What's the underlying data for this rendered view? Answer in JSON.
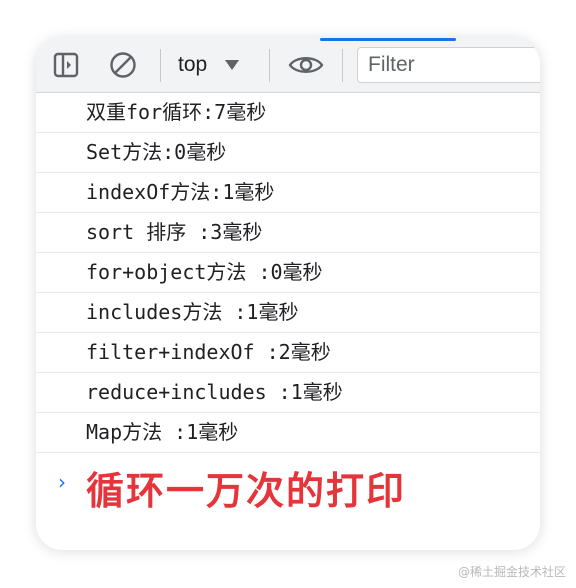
{
  "toolbar": {
    "context_label": "top",
    "filter_placeholder": "Filter"
  },
  "console": {
    "logs": [
      "双重for循环:7毫秒",
      "Set方法:0毫秒",
      "indexOf方法:1毫秒",
      "sort 排序 :3毫秒",
      "for+object方法 :0毫秒",
      "includes方法 :1毫秒",
      "filter+indexOf :2毫秒",
      "reduce+includes :1毫秒",
      "Map方法 :1毫秒"
    ],
    "prompt_chevron": "›",
    "prompt_text": "循环一万次的打印"
  },
  "colors": {
    "accent": "#1a73e8",
    "highlight_text": "#e5343a"
  },
  "watermark": "@稀土掘金技术社区"
}
